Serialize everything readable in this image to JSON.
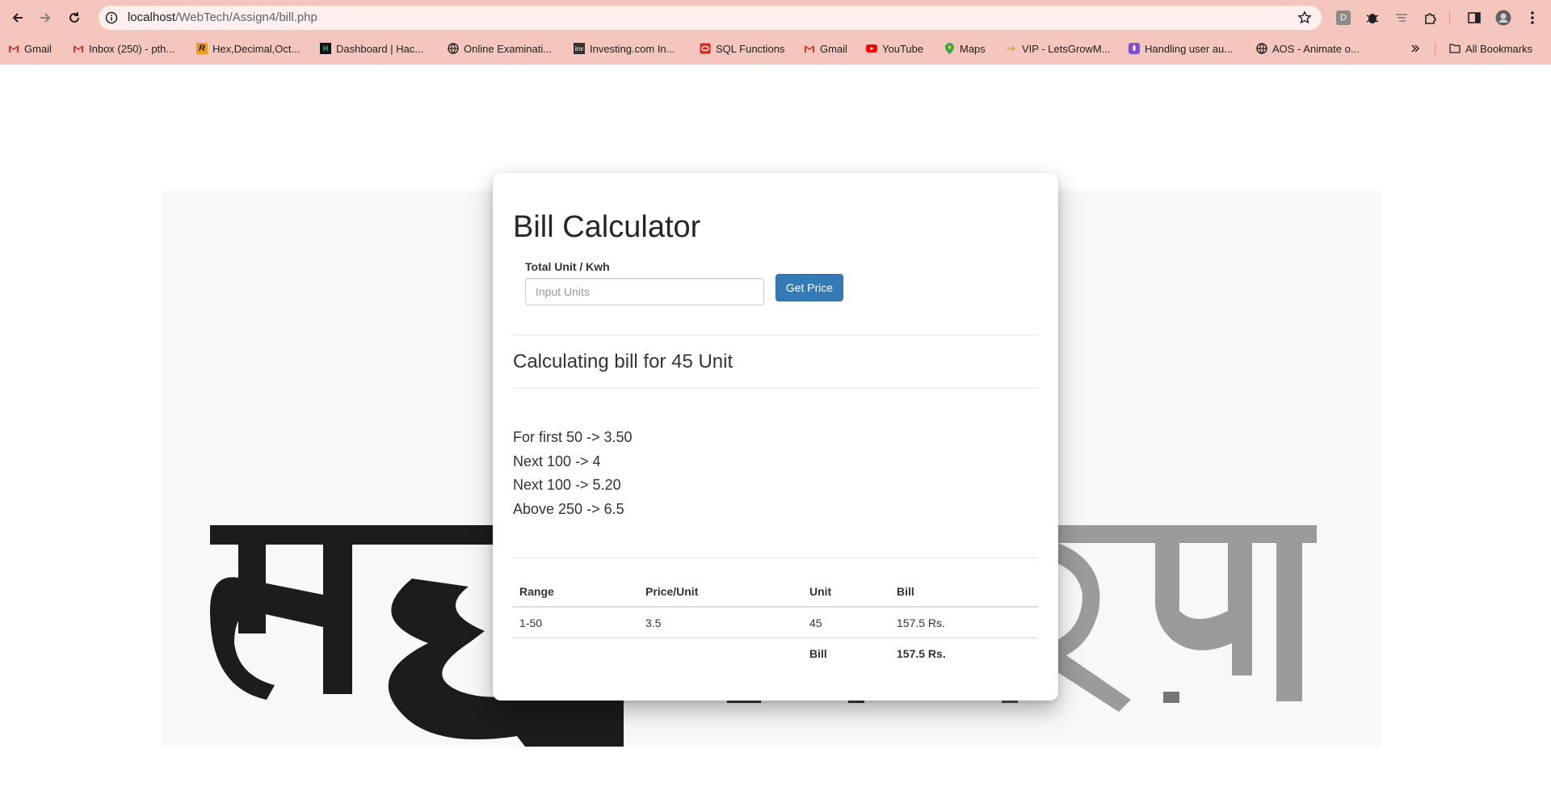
{
  "browser": {
    "url_host": "localhost",
    "url_path": "/WebTech/Assign4/bill.php",
    "bookmarks": [
      {
        "label": "Gmail",
        "icon": "gmail-icon"
      },
      {
        "label": "Inbox (250) - pth...",
        "icon": "gmail-icon"
      },
      {
        "label": "Hex,Decimal,Oct...",
        "icon": "r-logo-icon"
      },
      {
        "label": "Dashboard | Hac...",
        "icon": "hackerrank-icon"
      },
      {
        "label": "Online Examinati...",
        "icon": "globe-icon"
      },
      {
        "label": "Investing.com In...",
        "icon": "investing-icon"
      },
      {
        "label": "SQL Functions",
        "icon": "oracle-icon"
      },
      {
        "label": "Gmail",
        "icon": "gmail-icon"
      },
      {
        "label": "YouTube",
        "icon": "youtube-icon"
      },
      {
        "label": "Maps",
        "icon": "maps-pin-icon"
      },
      {
        "label": "VIP - LetsGrowM...",
        "icon": "arrow-icon"
      },
      {
        "label": "Handling user au...",
        "icon": "rocket-icon"
      },
      {
        "label": "AOS - Animate o...",
        "icon": "globe-icon"
      }
    ],
    "all_bookmarks_label": "All Bookmarks",
    "extension_d_label": "D"
  },
  "page": {
    "title": "Bill Calculator",
    "field_label": "Total Unit / Kwh",
    "input_placeholder": "Input Units",
    "input_value": "",
    "button_label": "Get Price",
    "calc_heading": "Calculating bill for 45 Unit",
    "rates": [
      "For first 50 -> 3.50",
      "Next 100 -> 4",
      "Next 100 -> 5.20",
      "Above 250 -> 6.5"
    ],
    "table": {
      "headers": [
        "Range",
        "Price/Unit",
        "Unit",
        "Bill"
      ],
      "rows": [
        [
          "1-50",
          "3.5",
          "45",
          "157.5 Rs."
        ]
      ],
      "total_label": "Bill",
      "total_value": "157.5 Rs."
    }
  },
  "colors": {
    "browser_chrome": "#f4c6bd",
    "button_primary": "#337ab7"
  }
}
